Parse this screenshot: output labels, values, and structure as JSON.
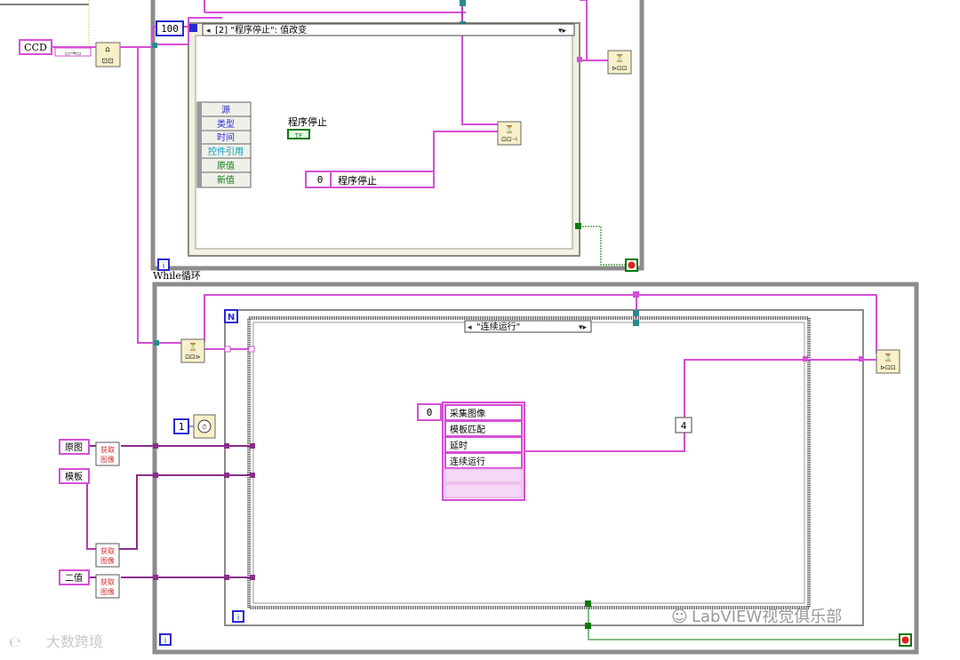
{
  "top_loop": {
    "ccd_label": "CCD",
    "timeout_value": "100",
    "event_case_selector": "[2] \"程序停止\": 值改变",
    "event_node_items": [
      "源",
      "类型",
      "时间",
      "控件引用",
      "原值",
      "新值"
    ],
    "terminal_label": "程序停止",
    "terminal_value": "TF",
    "enum_const_index": "0",
    "enum_const_value": "程序停止",
    "iteration_label": "i",
    "loop_label": "While循环"
  },
  "bottom_loop": {
    "loop_n_label": "N",
    "case_selector": "\"连续运行\"",
    "wait_const": "1",
    "enum_index": "0",
    "enum_items": [
      "采集图像",
      "模板匹配",
      "延时",
      "连续运行"
    ],
    "const_value": "4",
    "input_labels": [
      "原图",
      "模板",
      "二值"
    ],
    "getimage_text": "获取图像",
    "iteration_label": "i"
  },
  "watermarks": {
    "left": "大数跨境",
    "right": "LabVIEW视觉俱乐部"
  },
  "colors": {
    "wire_pink": "#d64fd6",
    "wire_purple": "#8a2d8a",
    "loop_frame": "#8c8c8c",
    "blue_label": "#2a2ad0",
    "green_label": "#0a7a0a",
    "cyan_label": "#00a0c0"
  }
}
